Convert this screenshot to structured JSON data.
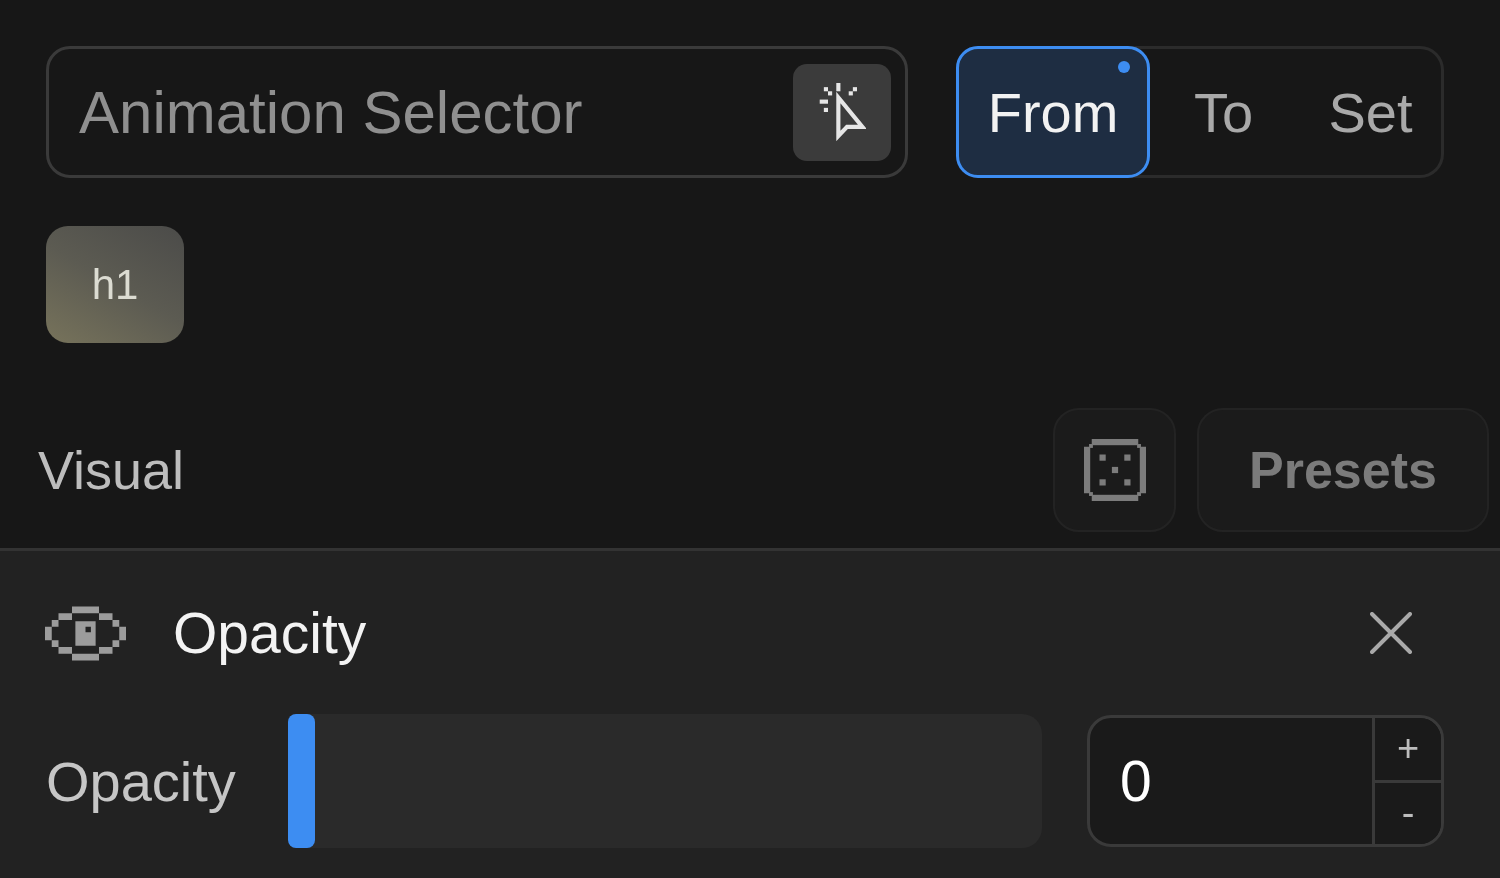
{
  "selector": {
    "placeholder": "Animation Selector"
  },
  "tabs": [
    {
      "label": "From",
      "selected": true,
      "modified": true
    },
    {
      "label": "To",
      "selected": false,
      "modified": false
    },
    {
      "label": "Set",
      "selected": false,
      "modified": false
    }
  ],
  "targets": [
    {
      "label": "h1"
    }
  ],
  "section": {
    "title": "Visual",
    "presets_label": "Presets"
  },
  "property": {
    "title": "Opacity"
  },
  "controls": [
    {
      "kind": "slider",
      "label": "Opacity",
      "level": 0,
      "value": "0",
      "increment": "+",
      "decrement": "-"
    }
  ]
}
